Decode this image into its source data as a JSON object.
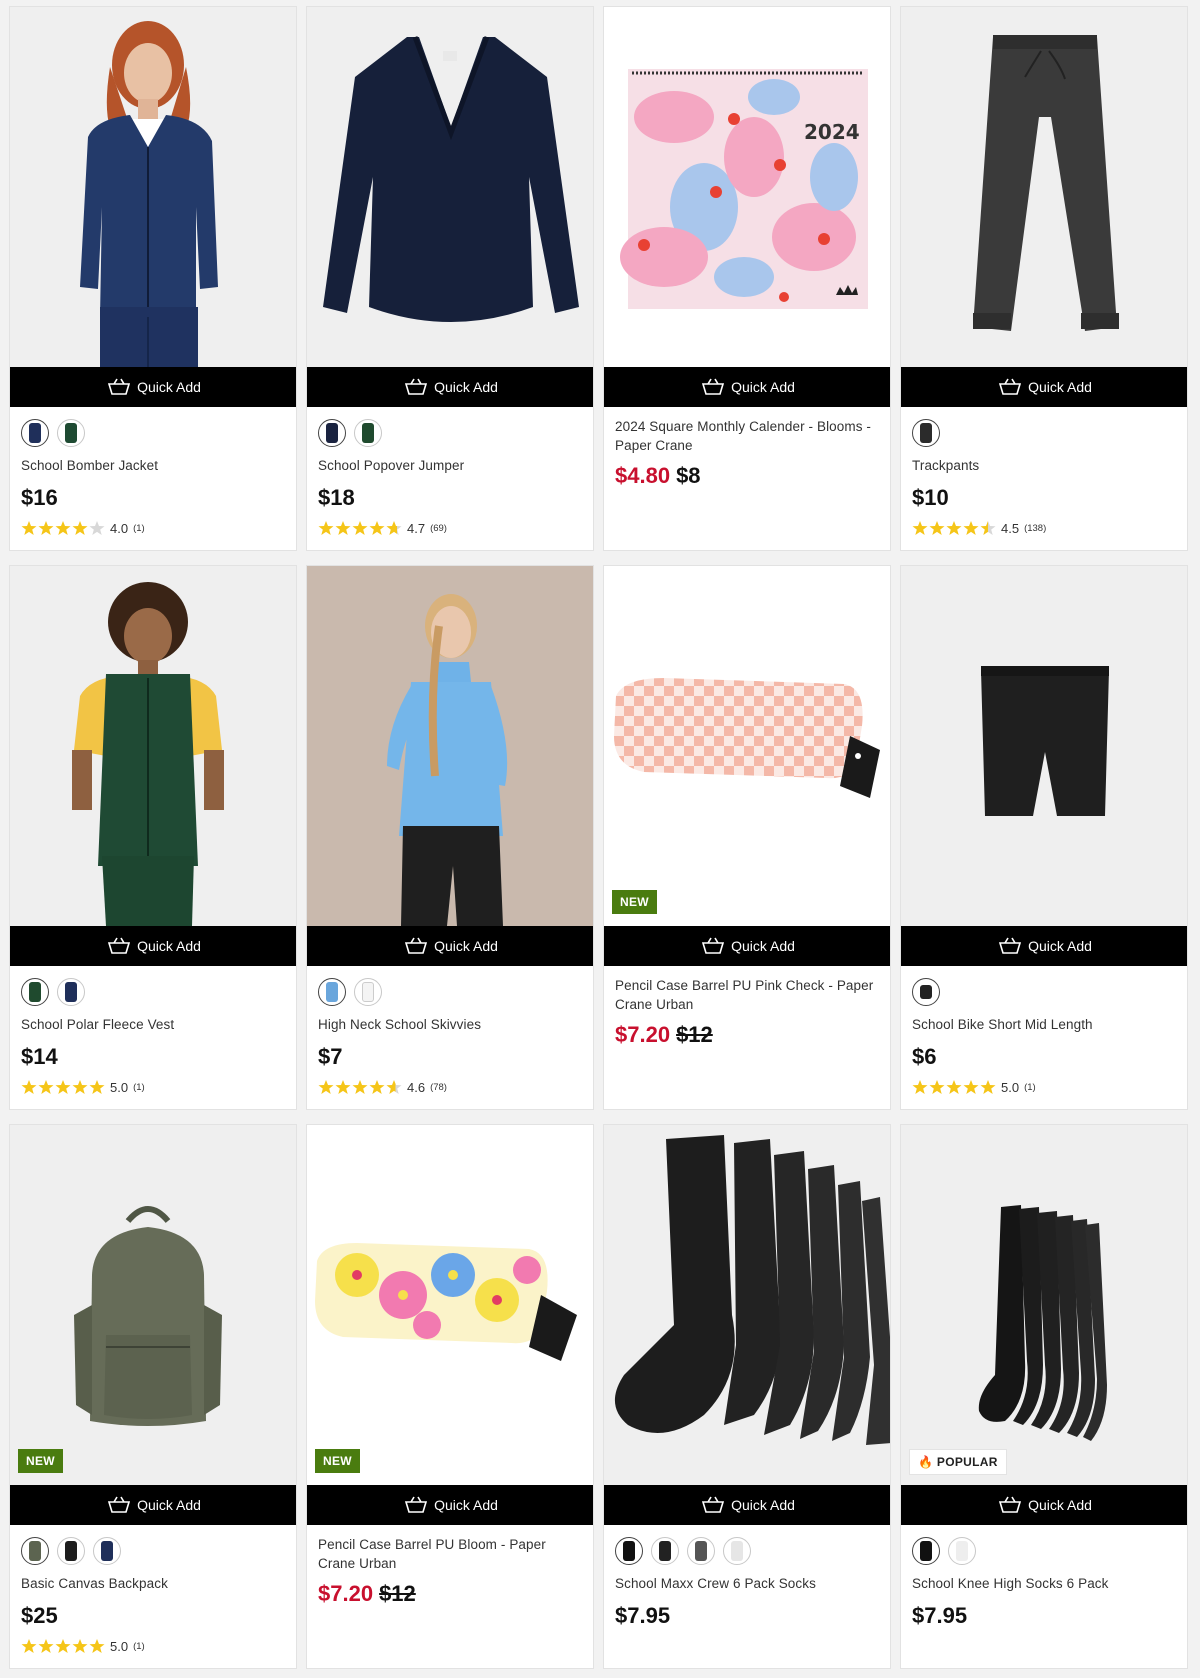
{
  "quick_add_label": "Quick Add",
  "colors": {
    "sale": "#c8102e",
    "star": "#f5c518",
    "new_badge": "#4a7c0f"
  },
  "products": [
    {
      "name": "School Bomber Jacket",
      "price": "$16",
      "rating": 4.0,
      "rating_text": "4.0",
      "reviews": "(1)",
      "swatches": [
        "#1f2f5a",
        "#1e4a32"
      ]
    },
    {
      "name": "School Popover Jumper",
      "price": "$18",
      "rating": 4.7,
      "rating_text": "4.7",
      "reviews": "(69)",
      "swatches": [
        "#1a2340",
        "#1f4a2e"
      ]
    },
    {
      "name": "2024 Square Monthly Calender - Blooms - Paper Crane",
      "sale_price": "$4.80",
      "was_price": "$8"
    },
    {
      "name": "Trackpants",
      "price": "$10",
      "rating": 4.5,
      "rating_text": "4.5",
      "reviews": "(138)",
      "swatches": [
        "#2b2b2b"
      ]
    },
    {
      "name": "School Polar Fleece Vest",
      "price": "$14",
      "rating": 5.0,
      "rating_text": "5.0",
      "reviews": "(1)",
      "swatches": [
        "#1f4a2e",
        "#1f2f5a"
      ]
    },
    {
      "name": "High Neck School Skivvies",
      "price": "$7",
      "rating": 4.6,
      "rating_text": "4.6",
      "reviews": "(78)",
      "swatches": [
        "#6aa6dc",
        "#f4f4f4"
      ]
    },
    {
      "name": "Pencil Case Barrel PU Pink Check - Paper Crane Urban",
      "sale_price": "$7.20",
      "was_price": "$12",
      "badge": "NEW"
    },
    {
      "name": "School Bike Short Mid Length",
      "price": "$6",
      "rating": 5.0,
      "rating_text": "5.0",
      "reviews": "(1)",
      "swatches": [
        "#222222"
      ]
    },
    {
      "name": "Basic Canvas Backpack",
      "price": "$25",
      "rating": 5.0,
      "rating_text": "5.0",
      "reviews": "(1)",
      "badge": "NEW",
      "swatches": [
        "#5c6450",
        "#1d1d1d",
        "#1f2f5a"
      ]
    },
    {
      "name": "Pencil Case Barrel PU Bloom - Paper Crane Urban",
      "sale_price": "$7.20",
      "was_price": "$12",
      "badge": "NEW"
    },
    {
      "name": "School Maxx Crew 6 Pack Socks",
      "price": "$7.95",
      "swatches": [
        "#111111",
        "#222222",
        "#555555",
        "#e6e6e6"
      ]
    },
    {
      "name": "School Knee High Socks 6 Pack",
      "price": "$7.95",
      "badge": "POPULAR",
      "swatches": [
        "#111111",
        "#eeeeee"
      ]
    }
  ]
}
